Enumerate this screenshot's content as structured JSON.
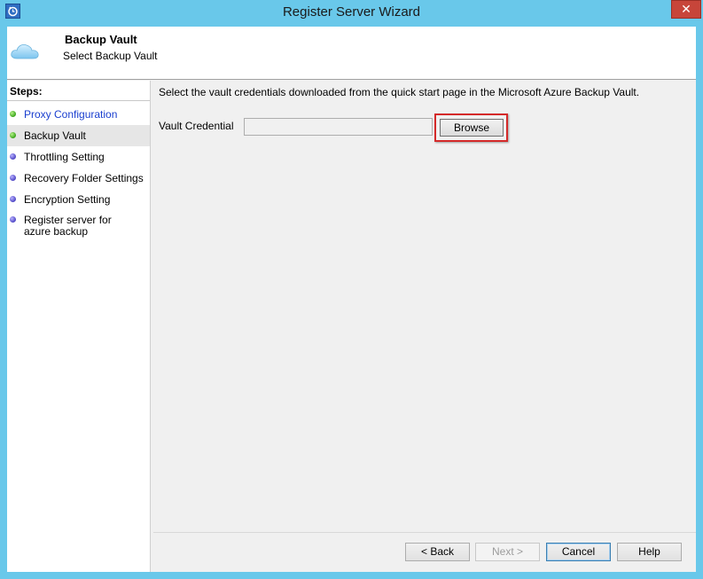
{
  "window": {
    "title": "Register Server Wizard",
    "close_glyph": "✕",
    "accent_color": "#69c8ea"
  },
  "header": {
    "icon": "cloud-icon",
    "title": "Backup Vault",
    "subtitle": "Select Backup Vault"
  },
  "steps": {
    "title": "Steps:",
    "items": [
      {
        "label": "Proxy Configuration",
        "state": "completed",
        "dot_color": "#3aa51b"
      },
      {
        "label": "Backup Vault",
        "state": "current",
        "dot_color": "#3aa51b"
      },
      {
        "label": "Throttling Setting",
        "state": "pending",
        "dot_color": "#4e46c4"
      },
      {
        "label": "Recovery Folder Settings",
        "state": "pending",
        "dot_color": "#4e46c4"
      },
      {
        "label": "Encryption Setting",
        "state": "pending",
        "dot_color": "#4e46c4"
      },
      {
        "label": "Register server for azure backup",
        "state": "pending",
        "dot_color": "#4e46c4"
      }
    ]
  },
  "main": {
    "instruction": "Select the vault credentials downloaded from the quick start page in the Microsoft Azure Backup Vault.",
    "vault_credential_label": "Vault Credential",
    "vault_credential_value": "",
    "browse_label": "Browse",
    "highlight_color": "#d42a2a"
  },
  "footer": {
    "back_label": "< Back",
    "next_label": "Next >",
    "cancel_label": "Cancel",
    "help_label": "Help"
  }
}
